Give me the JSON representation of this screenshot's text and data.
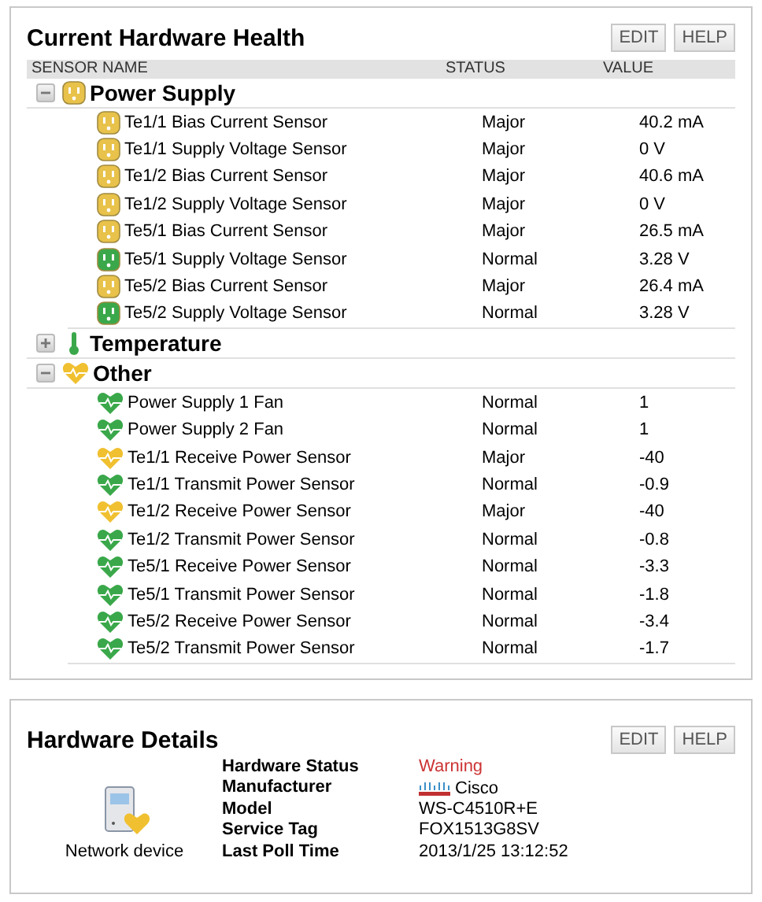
{
  "health": {
    "title": "Current Hardware Health",
    "buttons": [
      "EDIT",
      "HELP"
    ],
    "columns": [
      "SENSOR NAME",
      "STATUS",
      "VALUE"
    ],
    "groups": [
      {
        "name": "Power Supply",
        "expanded": true,
        "kind": "plug",
        "color": "#e8c24a",
        "children": [
          {
            "name": "Te1/1 Bias Current Sensor",
            "status": "Major",
            "value": "40.2 mA",
            "color": "#e8c24a"
          },
          {
            "name": "Te1/1 Supply Voltage Sensor",
            "status": "Major",
            "value": "0 V",
            "color": "#e8c24a"
          },
          {
            "name": "Te1/2 Bias Current Sensor",
            "status": "Major",
            "value": "40.6 mA",
            "color": "#e8c24a"
          },
          {
            "name": "Te1/2 Supply Voltage Sensor",
            "status": "Major",
            "value": "0 V",
            "color": "#e8c24a"
          },
          {
            "name": "Te5/1 Bias Current Sensor",
            "status": "Major",
            "value": "26.5 mA",
            "color": "#e8c24a"
          },
          {
            "name": "Te5/1 Supply Voltage Sensor",
            "status": "Normal",
            "value": "3.28 V",
            "color": "#3aa84a"
          },
          {
            "name": "Te5/2 Bias Current Sensor",
            "status": "Major",
            "value": "26.4 mA",
            "color": "#e8c24a"
          },
          {
            "name": "Te5/2 Supply Voltage Sensor",
            "status": "Normal",
            "value": "3.28 V",
            "color": "#3aa84a"
          }
        ]
      },
      {
        "name": "Temperature",
        "expanded": false,
        "kind": "thermometer",
        "color": "#3aa84a"
      },
      {
        "name": "Other",
        "expanded": true,
        "kind": "heart",
        "color": "#f0c030",
        "children": [
          {
            "name": "Power Supply 1 Fan",
            "status": "Normal",
            "value": "1",
            "color": "#3aa84a"
          },
          {
            "name": "Power Supply 2 Fan",
            "status": "Normal",
            "value": "1",
            "color": "#3aa84a"
          },
          {
            "name": "Te1/1 Receive Power Sensor",
            "status": "Major",
            "value": "-40",
            "color": "#f0c030"
          },
          {
            "name": "Te1/1 Transmit Power Sensor",
            "status": "Normal",
            "value": "-0.9",
            "color": "#3aa84a"
          },
          {
            "name": "Te1/2 Receive Power Sensor",
            "status": "Major",
            "value": "-40",
            "color": "#f0c030"
          },
          {
            "name": "Te1/2 Transmit Power Sensor",
            "status": "Normal",
            "value": "-0.8",
            "color": "#3aa84a"
          },
          {
            "name": "Te5/1 Receive Power Sensor",
            "status": "Normal",
            "value": "-3.3",
            "color": "#3aa84a"
          },
          {
            "name": "Te5/1 Transmit Power Sensor",
            "status": "Normal",
            "value": "-1.8",
            "color": "#3aa84a"
          },
          {
            "name": "Te5/2 Receive Power Sensor",
            "status": "Normal",
            "value": "-3.4",
            "color": "#3aa84a"
          },
          {
            "name": "Te5/2 Transmit Power Sensor",
            "status": "Normal",
            "value": "-1.7",
            "color": "#3aa84a"
          }
        ]
      }
    ]
  },
  "details": {
    "title": "Hardware Details",
    "buttons": [
      "EDIT",
      "HELP"
    ],
    "device_label": "Network device",
    "rows": [
      {
        "label": "Hardware Status",
        "value": "Warning",
        "kind": "alert"
      },
      {
        "label": "Manufacturer",
        "value": "Cisco",
        "kind": "vendor"
      },
      {
        "label": "Model",
        "value": "WS-C4510R+E",
        "kind": "text"
      },
      {
        "label": "Service Tag",
        "value": "FOX1513G8SV",
        "kind": "text"
      },
      {
        "label": "Last Poll Time",
        "value": "2013/1/25 13:12:52",
        "kind": "text"
      }
    ]
  }
}
